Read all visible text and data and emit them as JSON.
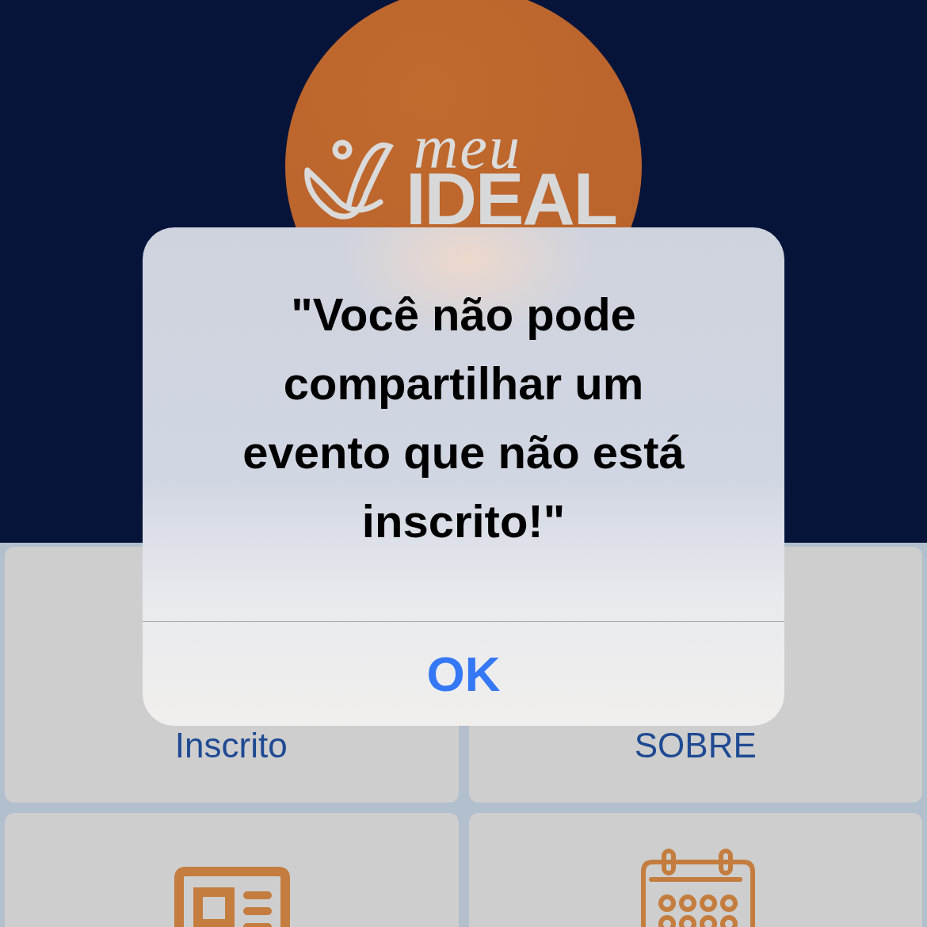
{
  "logo": {
    "script": "meu",
    "wordmark": "IDEAL"
  },
  "tiles": [
    {
      "kind": "label",
      "label": "Inscrito"
    },
    {
      "kind": "label",
      "label": "SOBRE"
    },
    {
      "kind": "news"
    },
    {
      "kind": "calendar"
    }
  ],
  "alert": {
    "message": "\"Você não pode compartilhar um evento que não está inscrito!\"",
    "button": "OK"
  }
}
